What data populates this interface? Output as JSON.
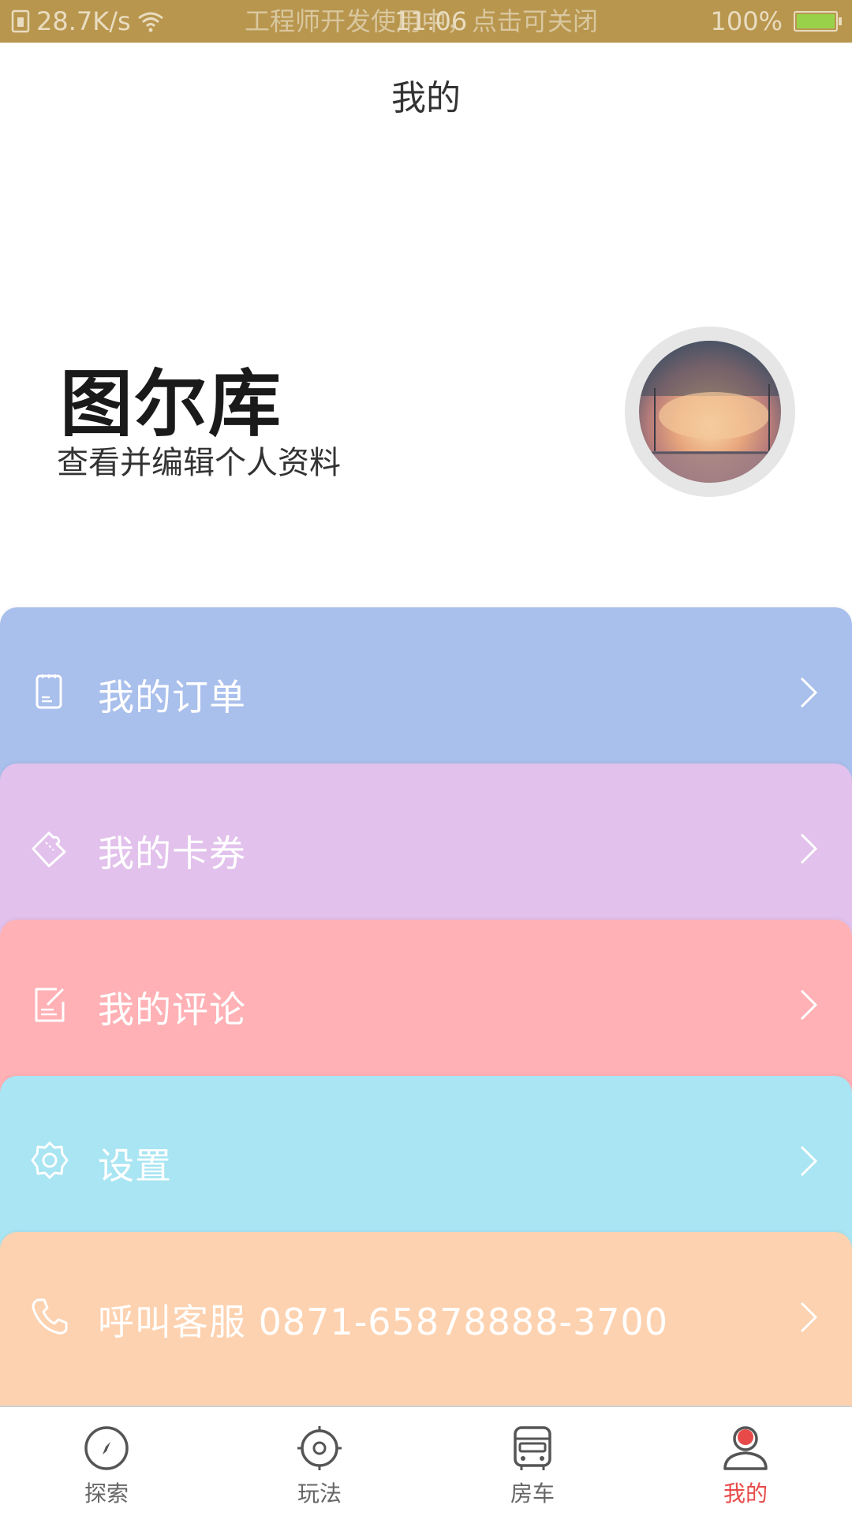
{
  "status_bar": {
    "speed": "28.7K/s",
    "notice": "工程师开发使用中，点击可关闭",
    "time": "11:06",
    "battery": "100%"
  },
  "header": {
    "title": "我的"
  },
  "profile": {
    "name": "图尔库",
    "subtitle": "查看并编辑个人资料"
  },
  "menu": [
    {
      "label": "我的订单",
      "icon": "order-icon",
      "color": "#a9bfec"
    },
    {
      "label": "我的卡券",
      "icon": "coupon-icon",
      "color": "#e2c1ec"
    },
    {
      "label": "我的评论",
      "icon": "comment-icon",
      "color": "#ffb1b5"
    },
    {
      "label": "设置",
      "icon": "settings-icon",
      "color": "#a9e5f2"
    },
    {
      "label": "呼叫客服 0871-65878888-3700",
      "icon": "phone-icon",
      "color": "#fdd2b0"
    }
  ],
  "tabs": [
    {
      "label": "探索",
      "icon": "compass-icon",
      "active": false
    },
    {
      "label": "玩法",
      "icon": "target-icon",
      "active": false
    },
    {
      "label": "房车",
      "icon": "bus-icon",
      "active": false
    },
    {
      "label": "我的",
      "icon": "user-icon",
      "active": true
    }
  ],
  "colors": {
    "accent": "#e84a4a",
    "status_bar": "#b8964e"
  }
}
